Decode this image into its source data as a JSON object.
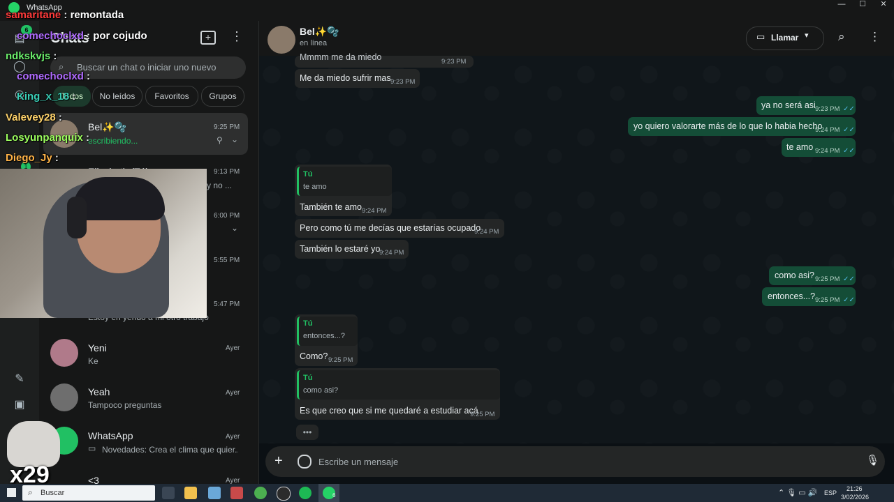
{
  "window": {
    "app_name": "WhatsApp",
    "min": "—",
    "max": "☐",
    "close": "✕"
  },
  "sidebar": {
    "title": "Chats",
    "new_chat_icon": "new-chat-icon",
    "menu_icon": "kebab-icon",
    "search_placeholder": "Buscar un chat o iniciar uno nuevo",
    "filters": [
      "Todos",
      "No leídos",
      "Favoritos",
      "Grupos"
    ],
    "rail_badges": {
      "chats": "6",
      "status": "1"
    }
  },
  "chats": [
    {
      "name": "Bel✨🫧",
      "preview": "escribiendo...",
      "time": "9:25 PM",
      "active": true
    },
    {
      "name": "Elizabeth (Tú)",
      "preview": "y no ...",
      "time": "9:13 PM"
    },
    {
      "name": "",
      "preview": "",
      "time": "6:00 PM"
    },
    {
      "name": "",
      "preview": "",
      "time": "5:55 PM"
    },
    {
      "name": "",
      "preview": "Estoy en yendo a mi otro trabajo",
      "time": "5:47 PM"
    },
    {
      "name": "Yeni",
      "preview": "Ke",
      "time": "Ayer"
    },
    {
      "name": "Yeah",
      "preview": "Tampoco preguntas",
      "time": "Ayer"
    },
    {
      "name": "WhatsApp",
      "preview": "Novedades: Crea el clima que quier...",
      "time": "Ayer"
    },
    {
      "name": "<3",
      "preview": "",
      "time": "Ayer"
    }
  ],
  "conversation": {
    "contact": "Bel✨🫧",
    "status": "en línea",
    "call_label": "Llamar",
    "composer_placeholder": "Escribe un mensaje",
    "messages_in": [
      {
        "text": "Mmmm me da miedo",
        "time": "9:23 PM"
      },
      {
        "text": "Me da miedo sufrir mas",
        "time": "9:23 PM"
      },
      {
        "quote_name": "Tú",
        "quote_text": "te amo",
        "text": "También te amo",
        "time": "9:24 PM"
      },
      {
        "text": "Pero como tú me decías que estarías ocupado",
        "time": "9:24 PM"
      },
      {
        "text": "También lo estaré yo",
        "time": "9:24 PM"
      },
      {
        "quote_name": "Tú",
        "quote_text": "entonces...?",
        "text": "Como?",
        "time": "9:25 PM"
      },
      {
        "quote_name": "Tú",
        "quote_text": "como asi?",
        "text": "Es que creo que si me quedaré a estudiar acá",
        "time": "9:25 PM"
      }
    ],
    "messages_out": [
      {
        "text": "ya no será asi",
        "time": "9:23 PM"
      },
      {
        "text": "yo quiero valorarte más de lo que lo habia hecho",
        "time": "9:24 PM"
      },
      {
        "text": "te amo",
        "time": "9:24 PM"
      },
      {
        "text": "como asi?",
        "time": "9:25 PM"
      },
      {
        "text": "entonces...?",
        "time": "9:25 PM"
      }
    ],
    "typing": "•••"
  },
  "stream_overlay": {
    "chat": [
      {
        "user": "samaritane",
        "msg": "remontada",
        "color": "#ff3b3b"
      },
      {
        "user": "comechoclxd",
        "msg": "por cojudo",
        "color": "#b06bff"
      },
      {
        "user": "ndkskvjs",
        "msg": "",
        "color": "#6cf06c"
      },
      {
        "user": "comechoclxd",
        "msg": "",
        "color": "#b06bff"
      },
      {
        "user": "King_x_18",
        "msg": "",
        "color": "#3ad0b8"
      },
      {
        "user": "Valevey28",
        "msg": "",
        "color": "#ffd36b"
      },
      {
        "user": "Losyunpanquix",
        "msg": "",
        "color": "#9cff5e"
      },
      {
        "user": "Diego_Jy",
        "msg": "",
        "color": "#ffb347"
      }
    ],
    "counter": "x29"
  },
  "taskbar": {
    "search": "Buscar",
    "lang": "ESP",
    "time": "21:26",
    "date": "3/02/2026",
    "whatsapp_badge": "6"
  }
}
